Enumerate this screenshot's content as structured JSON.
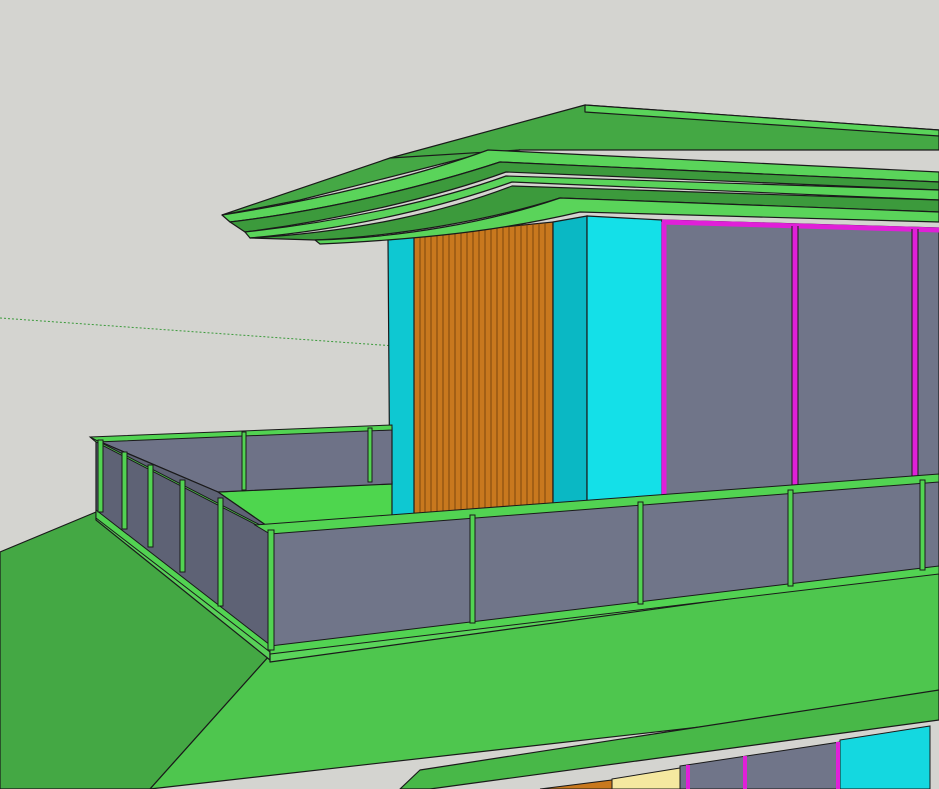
{
  "scene": {
    "description_visible_text": "",
    "colors": {
      "background": "#d4d4d0",
      "roof_green": "#44aa44",
      "roof_light": "#5ecf5e",
      "outline": "#1a1a1a",
      "cyan_panel": "#14d8e0",
      "cyan_dark": "#0ab8c4",
      "wood": "#c8781e",
      "glass": "#707589",
      "glass_dark": "#5e6275",
      "magenta_frame": "#e020d8",
      "rail_green": "#52d352",
      "pale_yellow": "#f5e8a0",
      "axis_guide": "#3a9a3a"
    }
  }
}
